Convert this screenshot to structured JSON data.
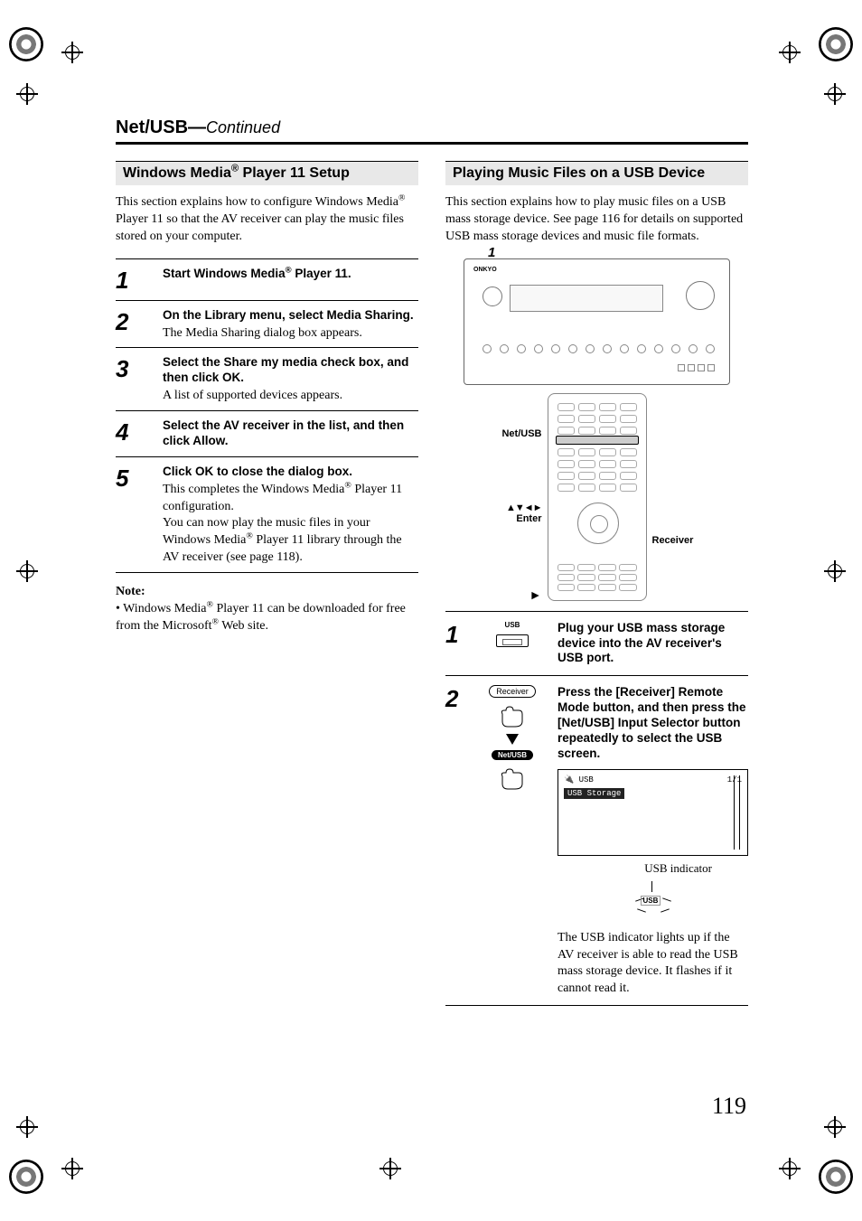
{
  "header": {
    "title": "Net/USB",
    "separator": "—",
    "continued": "Continued"
  },
  "left": {
    "heading_prefix": "Windows Media",
    "heading_suffix": " Player 11 Setup",
    "intro_prefix": "This section explains how to configure Windows Media",
    "intro_suffix": " Player 11 so that the AV receiver can play the music files stored on your computer.",
    "steps": [
      {
        "num": "1",
        "title_prefix": "Start Windows Media",
        "title_suffix": " Player 11.",
        "desc": ""
      },
      {
        "num": "2",
        "title": "On the Library menu, select Media Sharing.",
        "desc": "The Media Sharing dialog box appears."
      },
      {
        "num": "3",
        "title": "Select the Share my media check box, and then click OK.",
        "desc": "A list of supported devices appears."
      },
      {
        "num": "4",
        "title": "Select the AV receiver in the list, and then click Allow.",
        "desc": ""
      },
      {
        "num": "5",
        "title": "Click OK to close the dialog box.",
        "desc1_prefix": "This completes the Windows Media",
        "desc1_suffix": " Player 11 configuration.",
        "desc2_prefix": "You can now play the music files in your Windows Media",
        "desc2_suffix": " Player 11 library through the AV receiver (see page 118)."
      }
    ],
    "note": {
      "label": "Note:",
      "item_prefix": "Windows Media",
      "item_mid": " Player 11 can be downloaded for free from the Microsoft",
      "item_suffix": " Web site."
    }
  },
  "right": {
    "heading": "Playing Music Files on a USB Device",
    "intro": "This section explains how to play music files on a USB mass storage device. See page 116 for details on supported USB mass storage devices and music file formats.",
    "callout_1": "1",
    "receiver_brand": "ONKYO",
    "remote_labels": {
      "netusb": "Net/USB",
      "arrows": "▲▼◄►",
      "enter": "Enter",
      "receiver": "Receiver",
      "play": "►"
    },
    "steps": [
      {
        "num": "1",
        "usb_label": "USB",
        "title": "Plug your USB mass storage device into the AV receiver's USB port."
      },
      {
        "num": "2",
        "receiver_pill": "Receiver",
        "netusb_pill": "Net/USB",
        "title": "Press the [Receiver] Remote Mode button, and then press the [Net/USB] Input Selector button repeatedly to select the USB screen.",
        "screen": {
          "usb_head": "USB",
          "page": "1/1",
          "item": "USB Storage"
        },
        "indicator_label": "USB indicator",
        "indicator_icon": "USB",
        "desc": "The USB indicator lights up if the AV receiver is able to read the USB mass storage device. It flashes if it cannot read it."
      }
    ]
  },
  "page_number": "119"
}
